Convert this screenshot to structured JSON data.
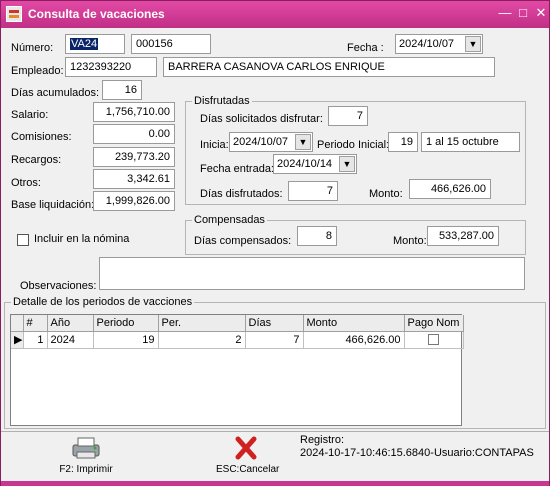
{
  "window": {
    "title": "Consulta de vacaciones",
    "icon": "app-icon",
    "controls": [
      "minimize-icon",
      "maximize-icon",
      "close-icon"
    ]
  },
  "form": {
    "numero_label": "Número:",
    "numero_prefix": "VA24",
    "numero_value": "000156",
    "fecha_label": "Fecha :",
    "fecha_value": "2024/10/07",
    "empleado_label": "Empleado:",
    "empleado_id": "1232393220",
    "empleado_nombre": "BARRERA CASANOVA CARLOS ENRIQUE",
    "dias_acum_label": "Días acumulados:",
    "dias_acum_value": "16",
    "salario_label": "Salario:",
    "salario_value": "1,756,710.00",
    "comisiones_label": "Comisiones:",
    "comisiones_value": "0.00",
    "recargos_label": "Recargos:",
    "recargos_value": "239,773.20",
    "otros_label": "Otros:",
    "otros_value": "3,342.61",
    "base_label": "Base liquidación:",
    "base_value": "1,999,826.00",
    "incluir_label": "Incluir en la nómina",
    "incluir_checked": false,
    "observaciones_label": "Observaciones:",
    "observaciones_value": ""
  },
  "disfrutadas": {
    "title": "Disfrutadas",
    "dias_sol_label": "Días solicitados disfrutar:",
    "dias_sol_value": "7",
    "inicia_label": "Inicia:",
    "inicia_value": "2024/10/07",
    "periodo_label": "Periodo Inicial:",
    "periodo_num": "19",
    "periodo_desc": "1 al 15 octubre",
    "fecha_entrada_label": "Fecha entrada:",
    "fecha_entrada_value": "2024/10/14",
    "dias_disf_label": "Días disfrutados:",
    "dias_disf_value": "7",
    "monto_label": "Monto:",
    "monto_value": "466,626.00"
  },
  "compensadas": {
    "title": "Compensadas",
    "dias_comp_label": "Días compensados:",
    "dias_comp_value": "8",
    "monto_label": "Monto:",
    "monto_value": "533,287.00"
  },
  "detalle": {
    "title": "Detalle de los periodos de vacciones",
    "columns": [
      "#",
      "Año",
      "Periodo",
      "Per.",
      "Días",
      "Monto",
      "Pago Nom"
    ],
    "rows": [
      {
        "num": "1",
        "anio": "2024",
        "periodo": "19",
        "per": "2",
        "dias": "7",
        "monto": "466,626.00",
        "pago_nom": false
      }
    ]
  },
  "footer": {
    "imprimir_label": "F2: Imprimir",
    "cancelar_label": "ESC:Cancelar",
    "registro_label": "Registro:",
    "registro_value": "2024-10-17-10:46:15.6840-Usuario:CONTAPAS"
  }
}
